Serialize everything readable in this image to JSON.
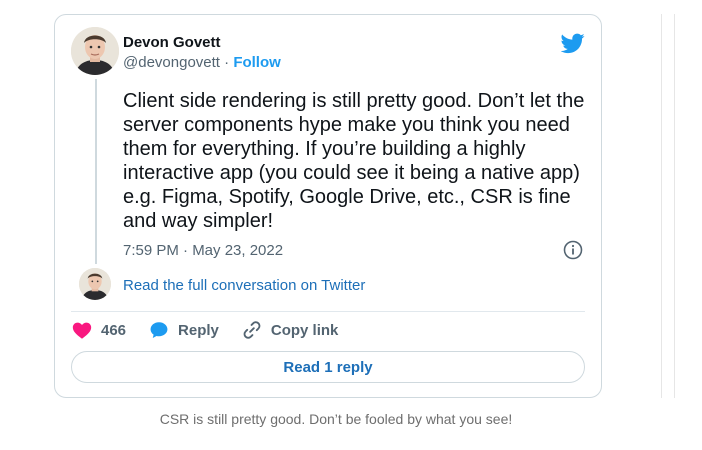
{
  "tweet": {
    "author_name": "Devon Govett",
    "handle": "@devongovett",
    "separator": "·",
    "follow_label": "Follow",
    "text": "Client side rendering is still pretty good. Don’t let the\nserver components hype make you think you need\nthem for everything. If you’re building a highly\ninteractive app (you could see it being a native app)\ne.g. Figma, Spotify, Google Drive, etc., CSR is fine\nand way simpler!",
    "timestamp": "7:59 PM · May 23, 2022",
    "read_conversation_label": "Read the full conversation on Twitter",
    "likes_count": "466",
    "reply_label": "Reply",
    "copy_link_label": "Copy link",
    "read_replies_label": "Read 1 reply"
  },
  "icons": {
    "logo": "twitter-bird-icon",
    "info": "info-icon",
    "like": "heart-icon",
    "reply": "speech-bubble-icon",
    "copy": "link-icon"
  },
  "colors": {
    "twitter_blue": "#1d9bf0",
    "link_blue": "#1d6fb8",
    "heart_pink": "#f91880",
    "muted_text": "#536471",
    "border": "#cfd9de"
  },
  "caption": "CSR is still pretty good. Don’t be fooled by what you see!"
}
